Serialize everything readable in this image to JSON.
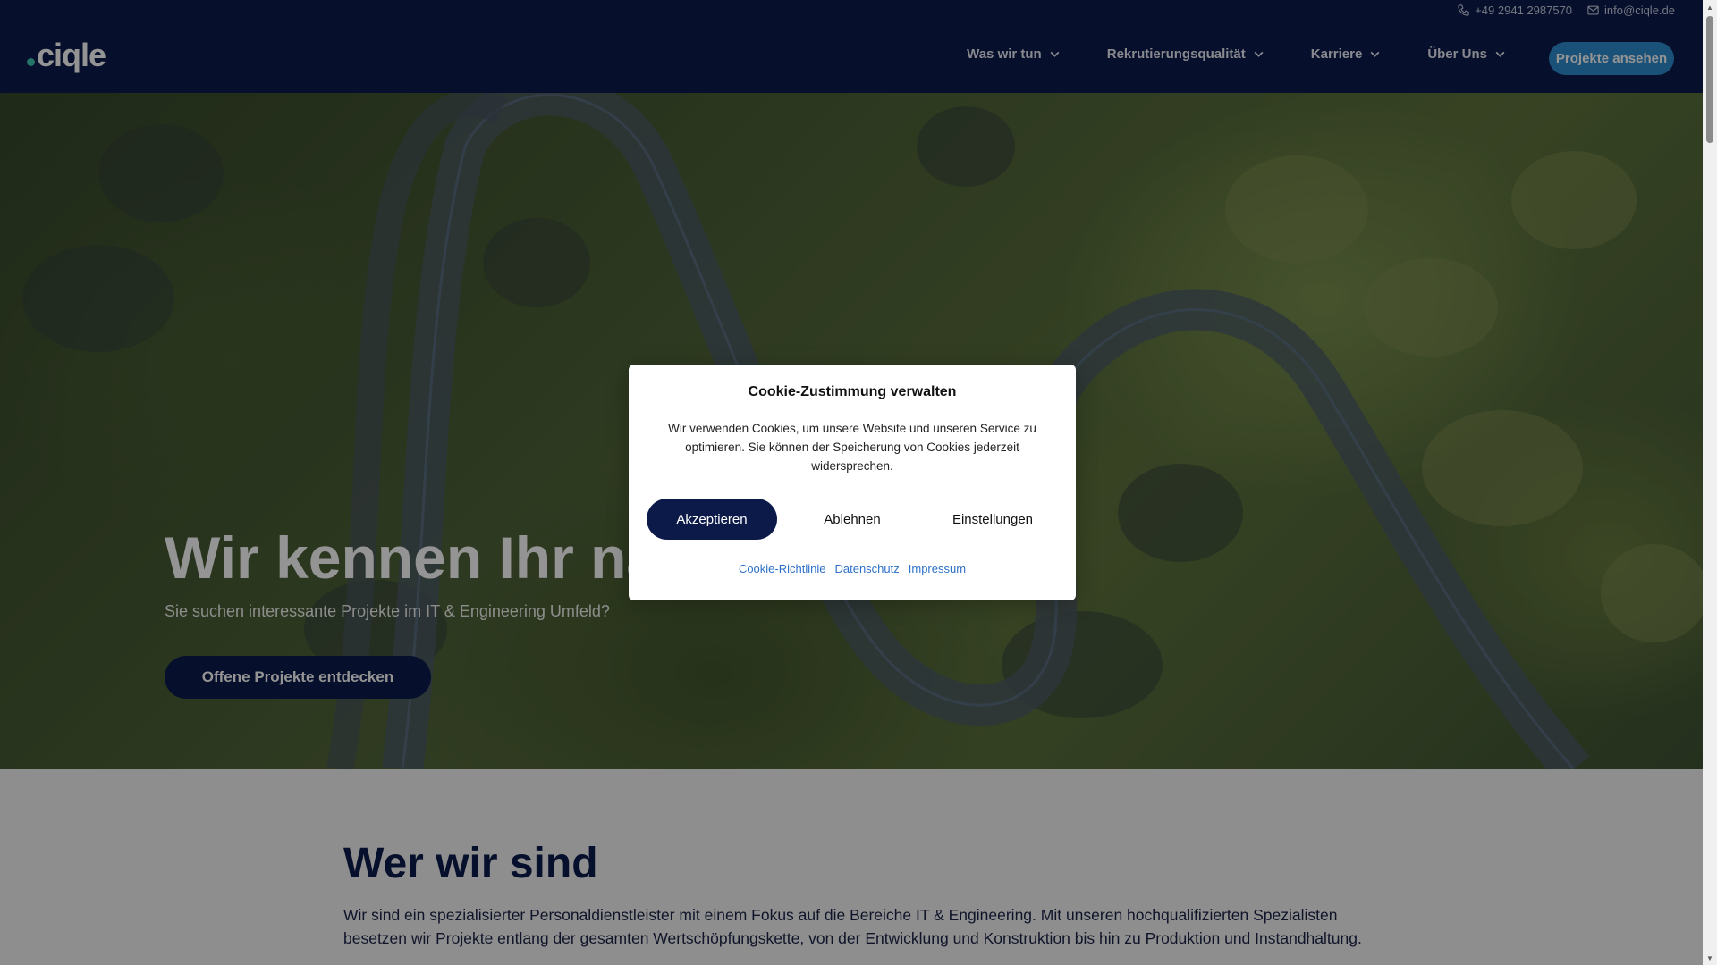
{
  "header": {
    "logo": "ciqle",
    "phone": "+49 2941 2987570",
    "email": "info@ciqle.de",
    "nav": [
      {
        "label": "Was wir tun"
      },
      {
        "label": "Rekrutierungsqualität"
      },
      {
        "label": "Karriere"
      },
      {
        "label": "Über Uns"
      }
    ],
    "cta": "Projekte ansehen"
  },
  "hero": {
    "heading": "Wir kennen Ihr nä",
    "subtitle": "Sie suchen interessante Projekte im IT & Engineering Umfeld?",
    "cta": "Offene Projekte entdecken"
  },
  "who": {
    "title": "Wer wir sind",
    "text": "Wir sind ein spezialisierter Personaldienstleister mit einem Fokus auf die Bereiche IT & Engineering. Mit unseren hochqualifizierten Spezialisten besetzen wir Projekte entlang der gesamten Wertschöpfungskette, von der Entwicklung und Konstruktion bis hin zu Produktion und Instandhaltung."
  },
  "cookie": {
    "title": "Cookie-Zustimmung verwalten",
    "text": "Wir verwenden Cookies, um unsere Website und unseren Service zu optimieren. Sie können der Speicherung von Cookies jederzeit widersprechen.",
    "accept": "Akzeptieren",
    "decline": "Ablehnen",
    "settings": "Einstellungen",
    "links": [
      "Cookie-Richtlinie",
      "Datenschutz",
      "Impressum"
    ]
  },
  "colors": {
    "navy": "#0c1a4a",
    "accent_blue": "#2e8ccf",
    "link_blue": "#2e71c9",
    "logo_dot": "#41c9b4"
  },
  "icons": {
    "phone": "phone-icon",
    "email": "mail-icon",
    "chevron": "chevron-down-icon"
  }
}
